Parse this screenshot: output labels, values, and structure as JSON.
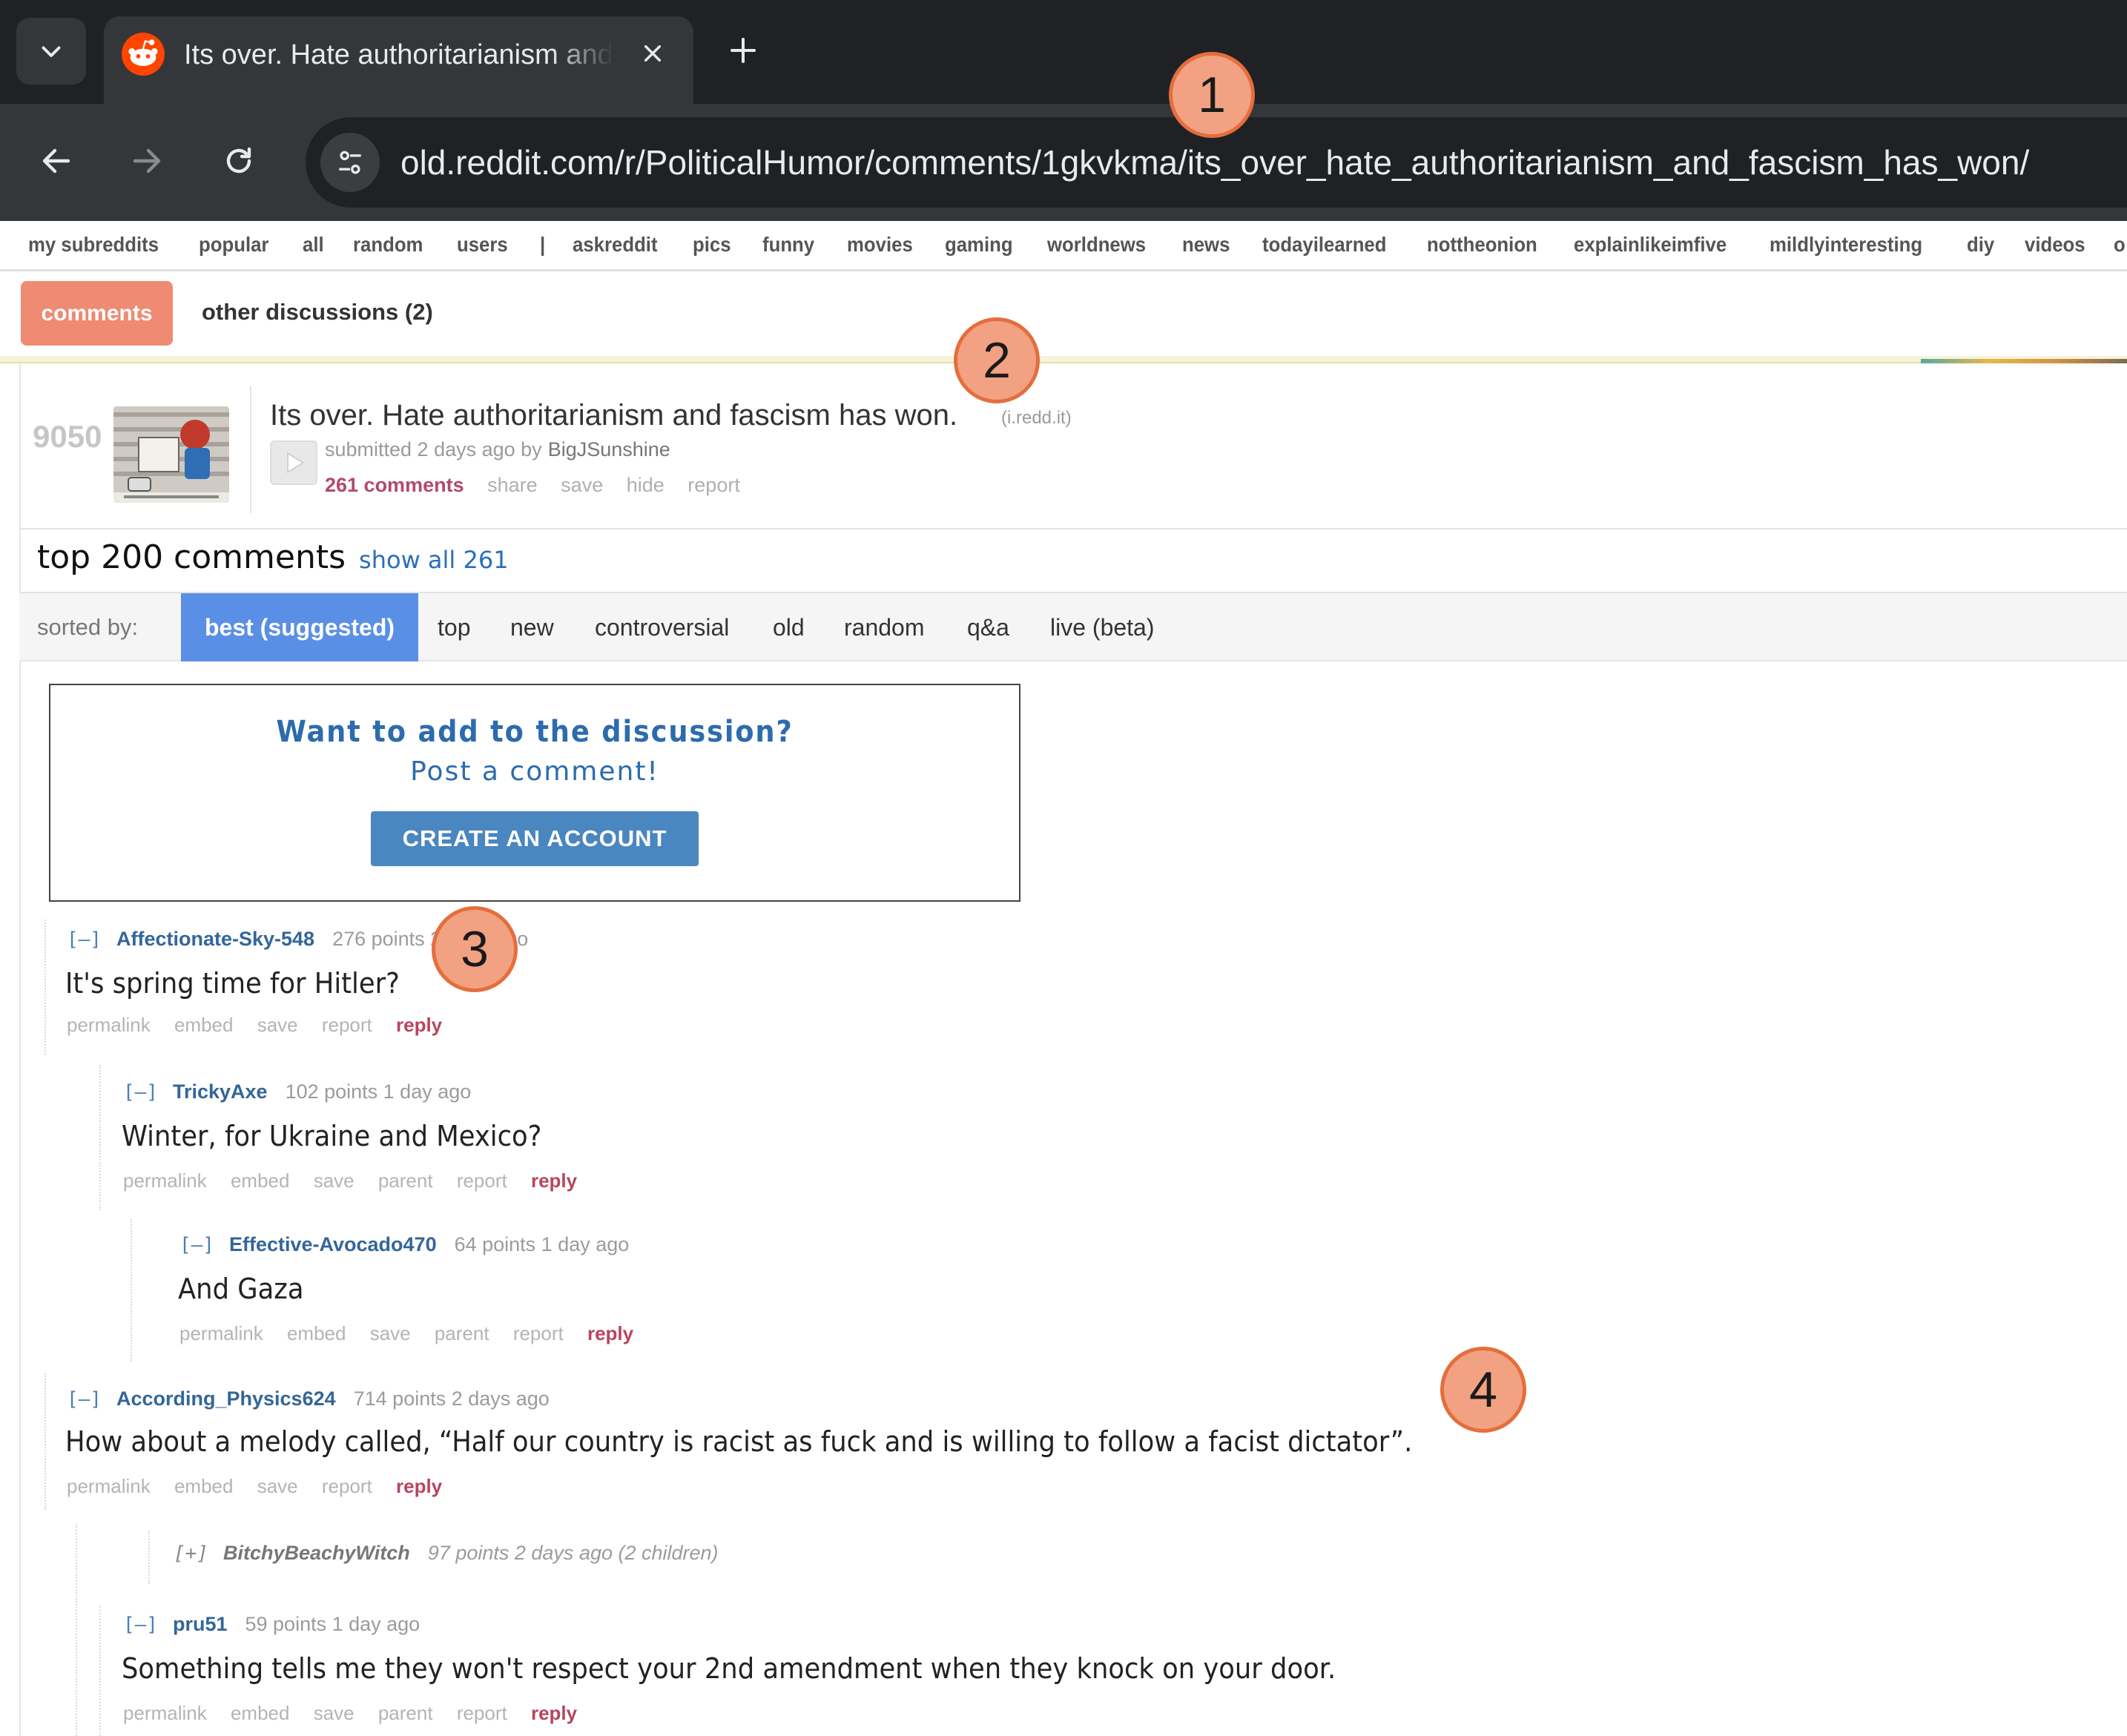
{
  "browser": {
    "tab_title": "Its over. Hate authoritarianism and fascism has won.",
    "url": "old.reddit.com/r/PoliticalHumor/comments/1gkvkma/its_over_hate_authoritarianism_and_fascism_has_won/"
  },
  "subreddit_bar": [
    "my subreddits",
    "popular",
    "all",
    "random",
    "users",
    "|",
    "askreddit",
    "pics",
    "funny",
    "movies",
    "gaming",
    "worldnews",
    "news",
    "todayilearned",
    "nottheonion",
    "explainlikeimfive",
    "mildlyinteresting",
    "diy",
    "videos",
    "o"
  ],
  "page_tabs": {
    "comments": "comments",
    "other": "other discussions (2)"
  },
  "post": {
    "score": "9050",
    "title": "Its over. Hate authoritarianism and fascism has won.",
    "domain": "(i.redd.it)",
    "submitted": "submitted 2 days ago by",
    "author": "BigJSunshine",
    "buttons": {
      "comments": "261 comments",
      "share": "share",
      "save": "save",
      "hide": "hide",
      "report": "report"
    }
  },
  "comments_header": {
    "title": "top 200 comments",
    "show_all": "show all 261"
  },
  "sort": {
    "label": "sorted by:",
    "active": "best (suggested)",
    "options": [
      "top",
      "new",
      "controversial",
      "old",
      "random",
      "q&a",
      "live (beta)"
    ]
  },
  "cta": {
    "title": "Want to add to the discussion?",
    "subtitle": "Post a comment!",
    "button": "CREATE AN ACCOUNT"
  },
  "comments": [
    {
      "toggle": "[–]",
      "user": "Affectionate-Sky-548",
      "meta": "276 points 2 days ago",
      "body": "It's spring time for Hitler?",
      "links": [
        "permalink",
        "embed",
        "save",
        "report"
      ],
      "reply": "reply"
    },
    {
      "toggle": "[–]",
      "user": "TrickyAxe",
      "meta": "102 points 1 day ago",
      "body": "Winter, for Ukraine and Mexico?",
      "links": [
        "permalink",
        "embed",
        "save",
        "parent",
        "report"
      ],
      "reply": "reply"
    },
    {
      "toggle": "[–]",
      "user": "Effective-Avocado470",
      "meta": "64 points 1 day ago",
      "body": "And Gaza",
      "links": [
        "permalink",
        "embed",
        "save",
        "parent",
        "report"
      ],
      "reply": "reply"
    },
    {
      "toggle": "[–]",
      "user": "According_Physics624",
      "meta": "714 points 2 days ago",
      "body": "How about a melody called, “Half our country is racist as fuck and is willing to follow a facist dictator”.",
      "links": [
        "permalink",
        "embed",
        "save",
        "report"
      ],
      "reply": "reply"
    },
    {
      "toggle": "[+]",
      "user": "BitchyBeachyWitch",
      "meta": "97 points 2 days ago (2 children)"
    },
    {
      "toggle": "[–]",
      "user": "pru51",
      "meta": "59 points 1 day ago",
      "body": "Something tells me they won't respect your 2nd amendment when they knock on your door.",
      "links": [
        "permalink",
        "embed",
        "save",
        "parent",
        "report"
      ],
      "reply": "reply"
    }
  ],
  "markers": [
    "1",
    "2",
    "3",
    "4"
  ],
  "colors": {
    "accent_tab": "#ef8a73",
    "sort_active": "#5a8fe6",
    "username": "#336699",
    "reply": "#b8455f",
    "marker_fill": "#f2a283",
    "marker_border": "#e46e3c"
  }
}
